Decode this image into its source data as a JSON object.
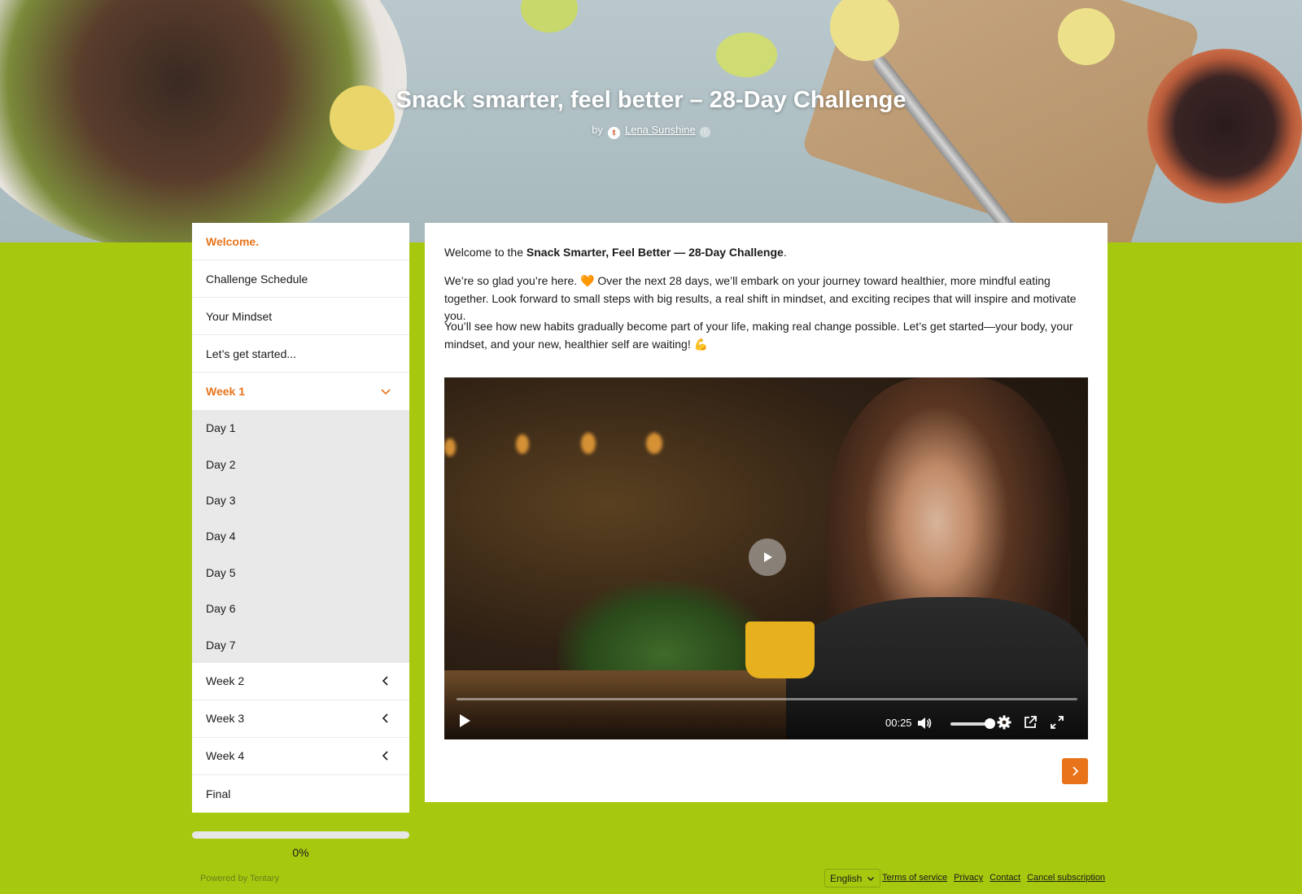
{
  "hero": {
    "title": "Snack smarter, feel better – 28-Day Challenge",
    "by_label": "by",
    "author_initial": "t",
    "author_name": "Lena Sunshine",
    "info_glyph": "i"
  },
  "sidebar": {
    "items": [
      {
        "label": "Welcome.",
        "active": true
      },
      {
        "label": "Challenge Schedule"
      },
      {
        "label": "Your Mindset"
      },
      {
        "label": "Let’s get started..."
      }
    ],
    "week1": {
      "label": "Week 1",
      "expanded": true,
      "days": [
        "Day 1",
        "Day 2",
        "Day 3",
        "Day 4",
        "Day 5",
        "Day 6",
        "Day 7"
      ]
    },
    "weeks_collapsed": [
      "Week 2",
      "Week 3",
      "Week 4"
    ],
    "final": "Final",
    "progress_percent": 0,
    "progress_label": "0%"
  },
  "content": {
    "intro_prefix": "Welcome to the ",
    "intro_bold": "Snack Smarter, Feel Better — 28-Day Challenge",
    "intro_suffix": ".",
    "paragraph2": "We’re so glad you’re here. 🧡 Over the next 28 days, we’ll embark on your journey toward healthier, more mindful eating together. Look forward to small steps with big results, a real shift in mindset, and exciting recipes that will inspire and motivate you.",
    "paragraph3": "You’ll see how new habits gradually become part of your life, making real change possible. Let’s get started—your body, your mindset, and your new, healthier self are waiting! 💪",
    "video": {
      "time": "00:25",
      "volume_level": 0.8,
      "progress": 0
    }
  },
  "footer": {
    "powered_by": "Powered by Tentary",
    "language": "English",
    "links": [
      "Terms of service",
      "Privacy",
      "Contact",
      "Cancel subscription"
    ]
  },
  "colors": {
    "accent": "#e8731a",
    "background": "#a6c90f"
  }
}
